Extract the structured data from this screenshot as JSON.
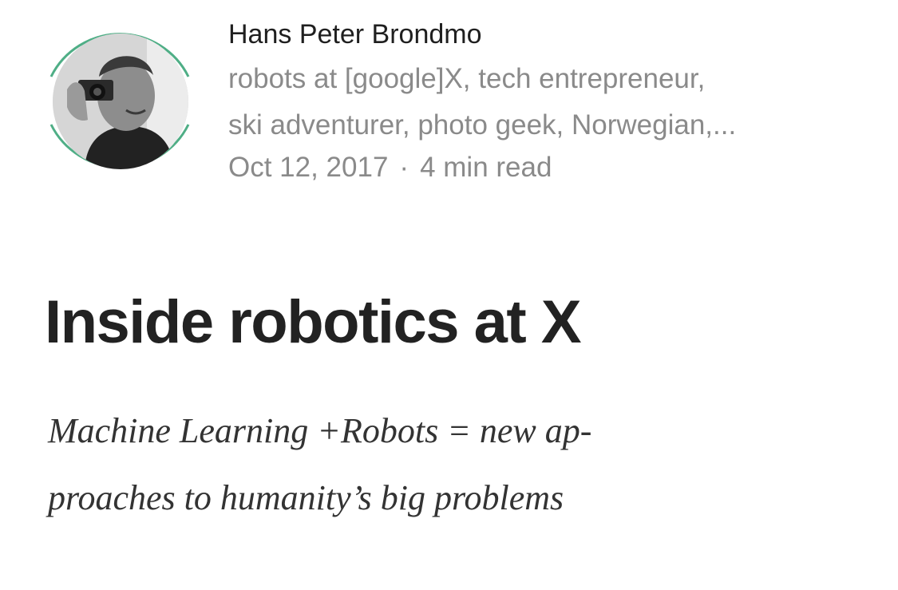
{
  "author": {
    "name": "Hans Peter Brondmo",
    "bio_line1": "robots at [google]X, tech entrepreneur,",
    "bio_line2": "ski adventurer, photo geek, Norwegian,...",
    "avatar_ring_color": "#4fae86",
    "avatar_style": "grayscale-photo"
  },
  "post": {
    "date": "Oct 12, 2017",
    "separator": "·",
    "read_time": "4 min read",
    "title": "Inside robotics at X",
    "subtitle_line1": "Machine Learning +Robots = new ap-",
    "subtitle_line2": "proaches to humanity’s big problems"
  }
}
